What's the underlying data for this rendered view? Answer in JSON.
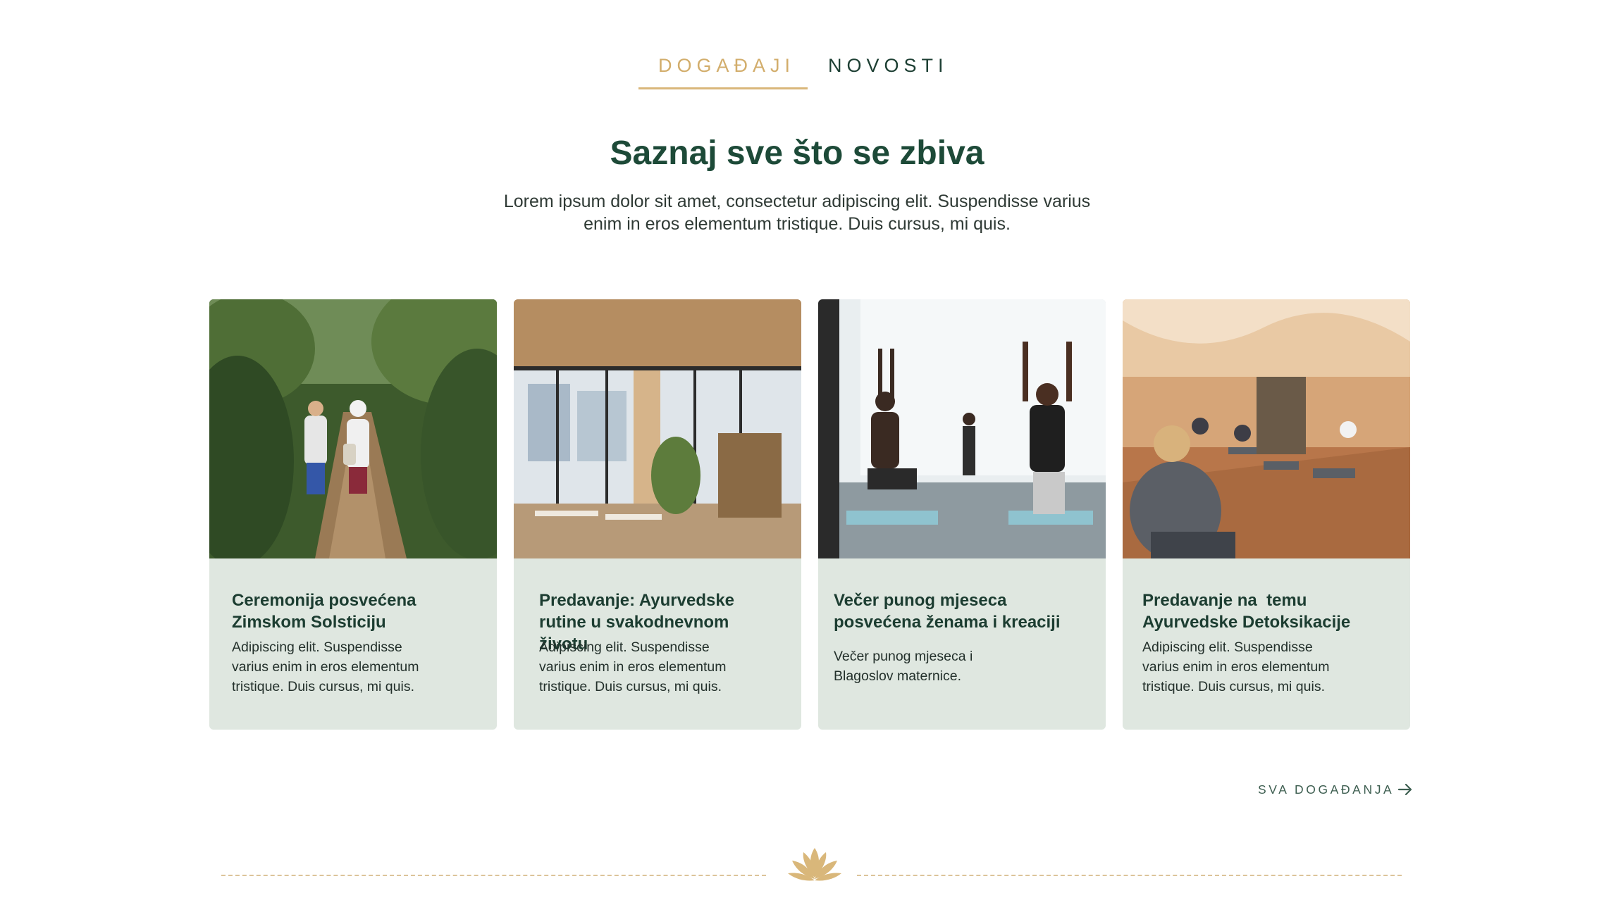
{
  "tabs": {
    "events_label": "DOGAĐAJI",
    "news_label": "NOVOSTI",
    "active": "events"
  },
  "section": {
    "title": "Saznaj sve što se zbiva",
    "intro_line1": "Lorem ipsum dolor sit amet, consectetur adipiscing elit. Suspendisse varius",
    "intro_line2": "enim in eros elementum tristique. Duis cursus, mi quis."
  },
  "events": [
    {
      "title_line1": "Ceremonija posvećena",
      "title_line2": "Zimskom Solsticiju",
      "text_line1": "Adipiscing elit. Suspendisse",
      "text_line2": "varius enim in eros elementum",
      "text_line3": "tristique. Duis cursus, mi quis.",
      "image": "forest-trail-walkers-photo"
    },
    {
      "title_line1": "Predavanje: Ayurvedske",
      "title_line2": "rutine u svakodnevnom",
      "title_line3": "životu",
      "text_line1": "Adipiscing elit. Suspendisse",
      "text_line2": "varius enim in eros elementum",
      "text_line3": "tristique. Duis cursus, mi quis.",
      "image": "wooden-cafe-interior-photo"
    },
    {
      "title_line1": "Večer punog mjeseca",
      "title_line2": "posvećena ženama i kreaciji",
      "text_line1": "Večer punog mjeseca i",
      "text_line2": "Blagoslov maternice.",
      "image": "yoga-class-photo"
    },
    {
      "title_line1": "Predavanje na  temu",
      "title_line2": "Ayurvedske Detoksikacije",
      "text_line1": "Adipiscing elit. Suspendisse",
      "text_line2": "varius enim in eros elementum",
      "text_line3": "tristique. Duis cursus, mi quis.",
      "image": "meditation-hall-photo"
    }
  ],
  "all_events_link": {
    "label": "SVA DOGAĐANJA",
    "icon": "arrow-right-icon"
  },
  "divider": {
    "icon": "lotus-icon"
  },
  "colors": {
    "accent_gold": "#d2ad6b",
    "primary_green": "#1d4a38",
    "card_bg": "#dfe7e0"
  }
}
